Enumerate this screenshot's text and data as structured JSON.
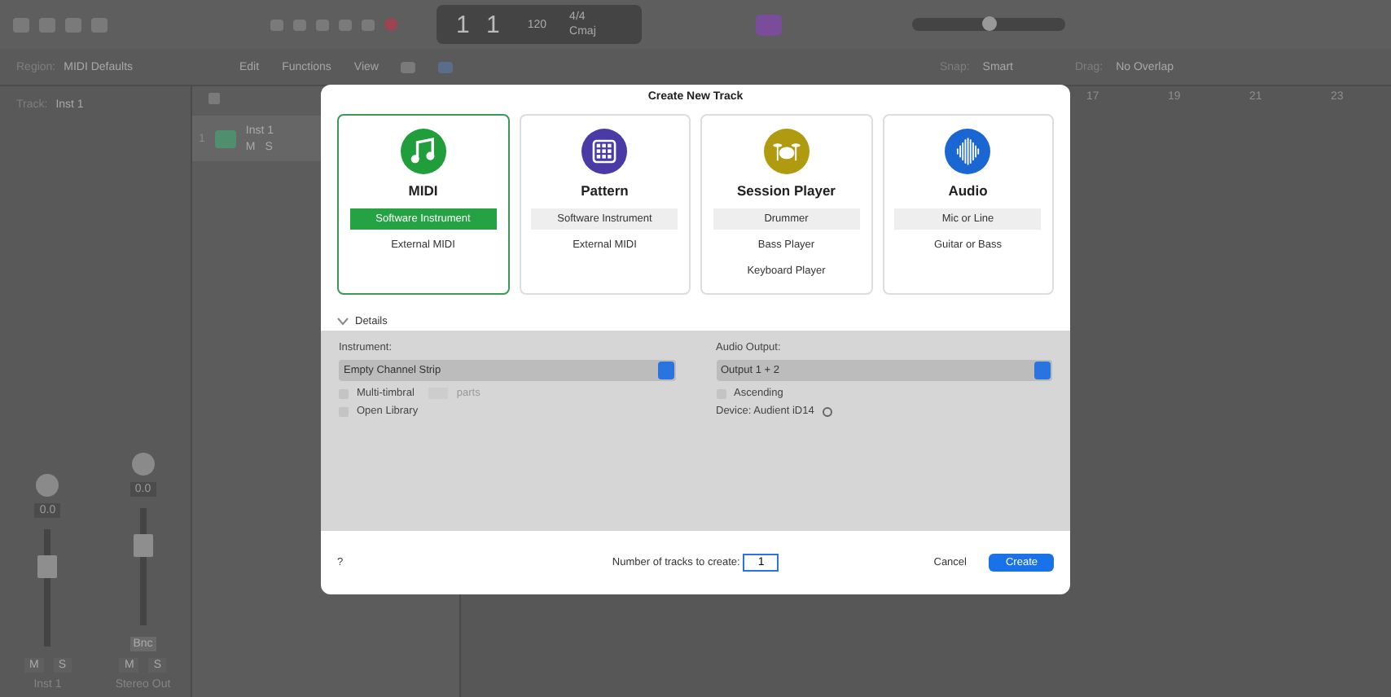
{
  "toolbar": {
    "master_volume": {
      "level": 0.5
    },
    "position": "1 1",
    "tempo": "120",
    "signature": "4/4",
    "key": "Cmaj"
  },
  "inspector": {
    "region_label": "Region:",
    "region": "MIDI Defaults",
    "track_label": "Track:",
    "track": "Inst 1"
  },
  "menus": [
    "Edit",
    "Functions",
    "View"
  ],
  "snap": {
    "label": "Snap:",
    "value": "Smart"
  },
  "drag": {
    "label": "Drag:",
    "value": "No Overlap"
  },
  "ruler": [
    "17",
    "19",
    "21",
    "23"
  ],
  "track": {
    "number": "1",
    "name": "Inst 1",
    "mute": "M",
    "solo": "S"
  },
  "mixer": [
    {
      "name": "Inst 1",
      "value": "0.0",
      "mute": "M",
      "solo": "S"
    },
    {
      "name": "Stereo Out",
      "value": "0.0",
      "mute": "M",
      "solo": "S",
      "bounce": "Bnc"
    }
  ],
  "dialog": {
    "title": "Create New Track",
    "types": [
      {
        "name": "MIDI",
        "kind": "note",
        "color": "#1f9e3b",
        "selected": true,
        "options": [
          {
            "label": "Software Instrument",
            "selected": true
          },
          {
            "label": "External MIDI",
            "selected": false
          }
        ]
      },
      {
        "name": "Pattern",
        "kind": "grid",
        "color": "#4a3aa6",
        "selected": false,
        "options": [
          {
            "label": "Software Instrument",
            "selected": true
          },
          {
            "label": "External MIDI",
            "selected": false
          }
        ]
      },
      {
        "name": "Session Player",
        "kind": "drums",
        "color": "#b09a10",
        "selected": false,
        "options": [
          {
            "label": "Drummer",
            "selected": true
          },
          {
            "label": "Bass Player",
            "selected": false
          },
          {
            "label": "Keyboard Player",
            "selected": false
          }
        ]
      },
      {
        "name": "Audio",
        "kind": "wave",
        "color": "#1a66d2",
        "selected": false,
        "options": [
          {
            "label": "Mic or Line",
            "selected": true
          },
          {
            "label": "Guitar or Bass",
            "selected": false
          }
        ]
      }
    ],
    "details": {
      "label": "Details",
      "expanded": true
    },
    "instrument": {
      "label": "Instrument:",
      "value": "Empty Channel Strip"
    },
    "multitimbral": {
      "label": "Multi-timbral",
      "checked": false,
      "parts": "parts"
    },
    "open_library": {
      "label": "Open Library",
      "checked": false
    },
    "audio_output": {
      "label": "Audio Output:",
      "value": "Output 1 + 2"
    },
    "ascending": {
      "label": "Ascending",
      "checked": false
    },
    "device": "Device: Audient iD14",
    "help": "?",
    "count_label": "Number of tracks to create:",
    "count": "1",
    "cancel": "Cancel",
    "create": "Create"
  }
}
